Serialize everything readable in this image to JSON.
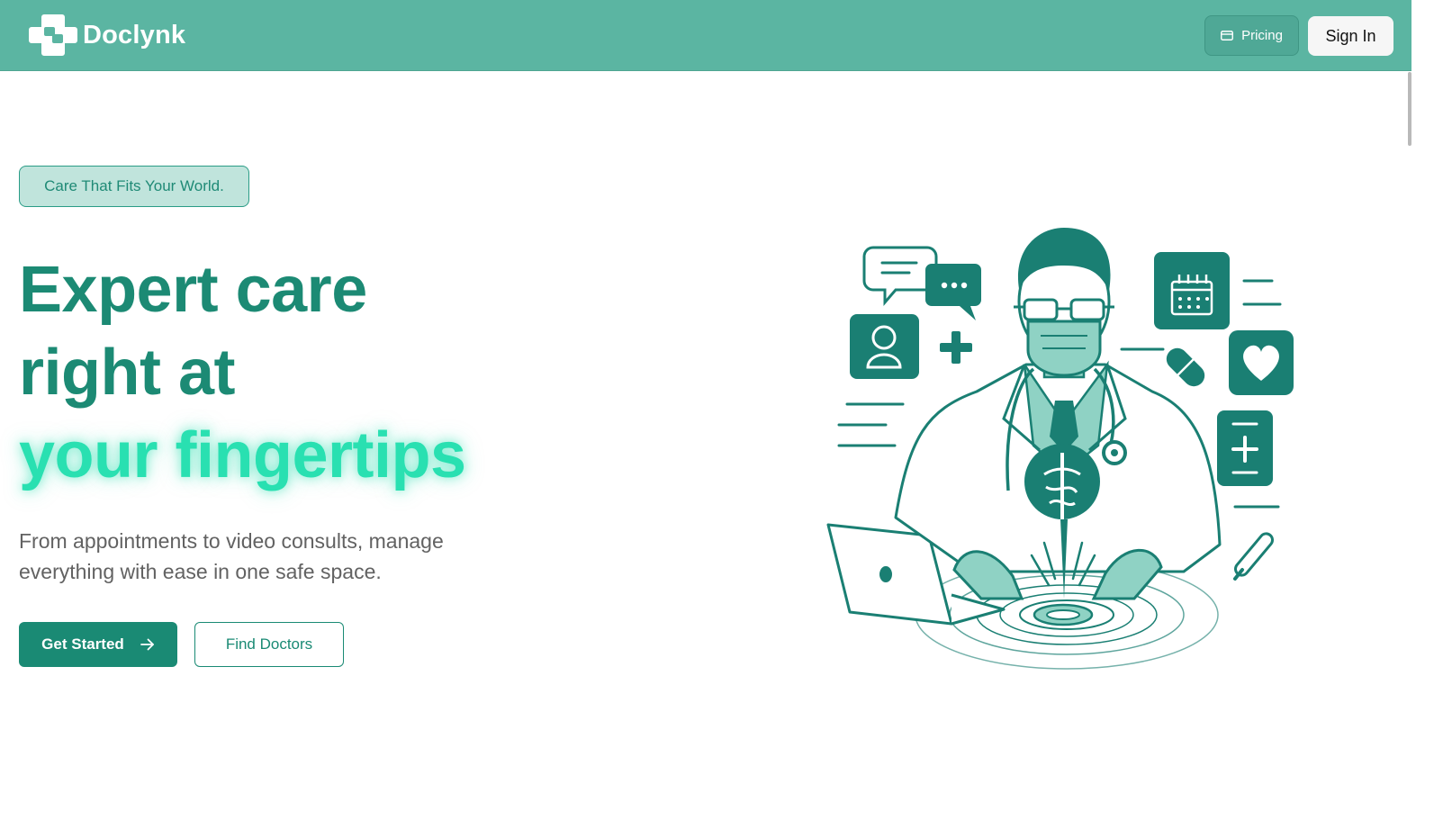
{
  "header": {
    "brand_name": "Doclynk",
    "logo_icon": "medical-cross-logo-icon",
    "pricing_label": "Pricing",
    "pricing_icon": "credit-card-icon",
    "signin_label": "Sign In"
  },
  "hero": {
    "tagline": "Care That Fits Your World.",
    "headline_line1": "Expert care",
    "headline_line2": "right at",
    "headline_line3": "your fingertips",
    "subtext": "From appointments to video consults, manage everything with ease in one safe space.",
    "primary_button": "Get Started",
    "primary_button_icon": "arrow-right-icon",
    "secondary_button": "Find Doctors"
  },
  "illustration": {
    "subject": "doctor-illustration",
    "icons": [
      "chat-bubble-icon",
      "message-dots-icon",
      "user-profile-icon",
      "plus-icon",
      "calendar-icon",
      "pill-icon",
      "heart-icon",
      "medical-kit-icon",
      "thermometer-icon",
      "caduceus-icon",
      "laptop-icon",
      "stethoscope-icon"
    ]
  },
  "colors": {
    "header_bg": "#5bb5a2",
    "primary": "#1a8a74",
    "accent_glow": "#29e0b1",
    "tagline_bg": "#c0e4dc",
    "illustration_stroke": "#1a7f73",
    "illustration_fill_light": "#8fd2c4"
  }
}
